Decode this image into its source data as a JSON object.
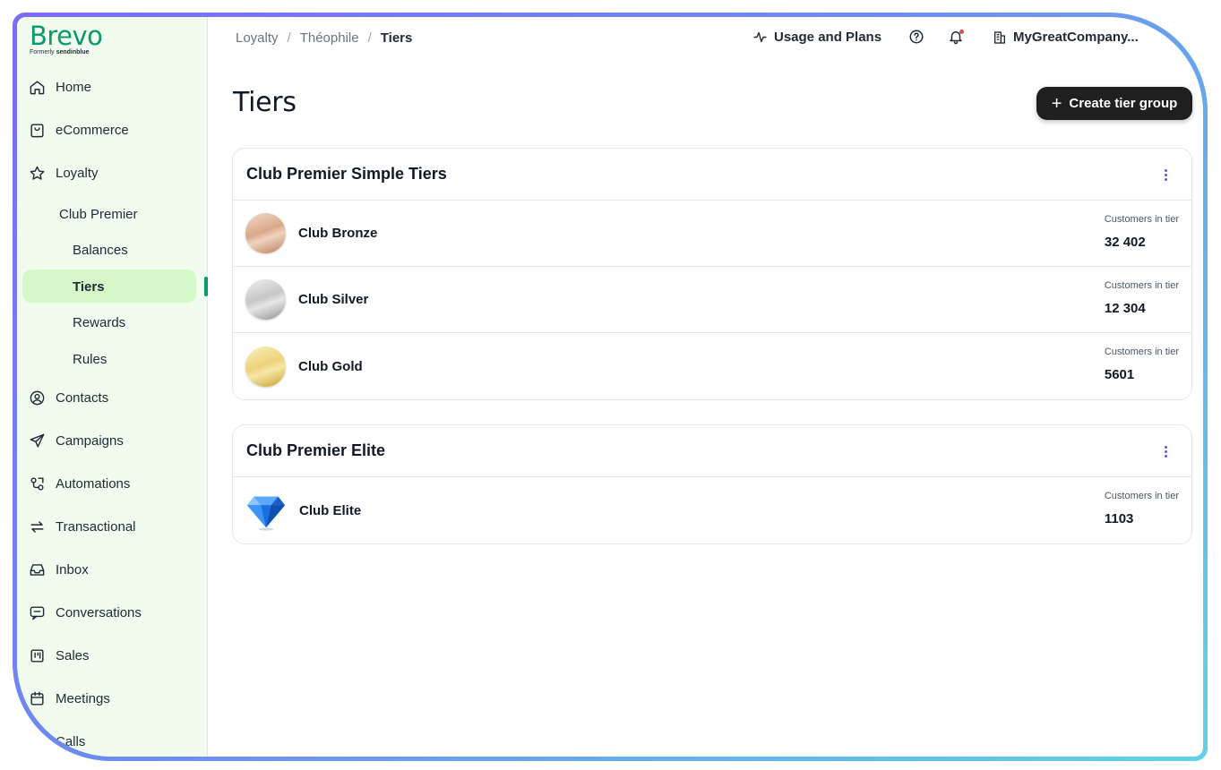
{
  "brand": {
    "logo": "Brevo",
    "formerly": "Formerly",
    "formerly_name": "sendinblue"
  },
  "sidebar": {
    "items": [
      {
        "label": "Home",
        "icon": "home-icon"
      },
      {
        "label": "eCommerce",
        "icon": "shopping-bag-icon"
      },
      {
        "label": "Loyalty",
        "icon": "star-icon"
      },
      {
        "label": "Contacts",
        "icon": "user-circle-icon"
      },
      {
        "label": "Campaigns",
        "icon": "send-icon"
      },
      {
        "label": "Automations",
        "icon": "automation-icon"
      },
      {
        "label": "Transactional",
        "icon": "arrows-swap-icon"
      },
      {
        "label": "Inbox",
        "icon": "inbox-icon"
      },
      {
        "label": "Conversations",
        "icon": "chat-icon"
      },
      {
        "label": "Sales",
        "icon": "kanban-icon"
      },
      {
        "label": "Meetings",
        "icon": "calendar-icon"
      },
      {
        "label": "Calls",
        "icon": "phone-icon"
      }
    ],
    "loyalty_program": "Club Premier",
    "subitems": [
      "Balances",
      "Tiers",
      "Rewards",
      "Rules"
    ],
    "active": "Tiers"
  },
  "breadcrumb": {
    "items": [
      "Loyalty",
      "Théophile",
      "Tiers"
    ],
    "separator": "/"
  },
  "topbar": {
    "usage": "Usage and Plans",
    "company": "MyGreatCompany..."
  },
  "page": {
    "title": "Tiers",
    "create_button": "Create tier group"
  },
  "groups": [
    {
      "title": "Club Premier Simple Tiers",
      "tiers": [
        {
          "name": "Club Bronze",
          "label": "Customers in tier",
          "count": "32 402",
          "badge": "bronze-medal"
        },
        {
          "name": "Club Silver",
          "label": "Customers in tier",
          "count": "12 304",
          "badge": "silver-medal"
        },
        {
          "name": "Club Gold",
          "label": "Customers in tier",
          "count": "5601",
          "badge": "gold-medal"
        }
      ]
    },
    {
      "title": "Club Premier Elite",
      "tiers": [
        {
          "name": "Club Elite",
          "label": "Customers in tier",
          "count": "1103",
          "badge": "diamond"
        }
      ]
    }
  ],
  "colors": {
    "brand_green": "#0b996e",
    "sidebar_bg": "#f1fcef",
    "active_bg": "#d6f8c9",
    "button_dark": "#1f1f1f",
    "kebab": "#5b5bd6"
  }
}
